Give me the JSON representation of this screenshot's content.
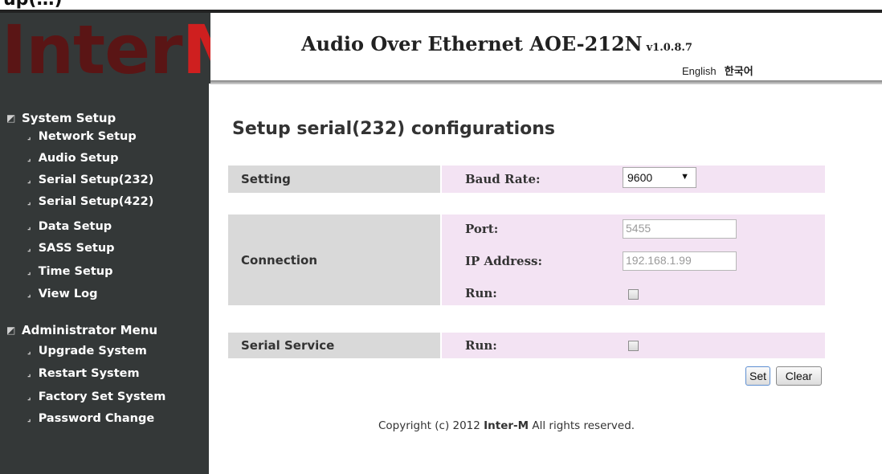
{
  "top_caption": "up(…)",
  "logo": {
    "main": "Inter",
    "accent": "M"
  },
  "header": {
    "title": "Audio Over Ethernet AOE-212N",
    "version": "v1.0.8.7",
    "languages": {
      "english": "English",
      "korean": "한국어"
    }
  },
  "sidebar": {
    "sections": [
      {
        "title": "System Setup",
        "items": [
          "Network Setup",
          "Audio Setup",
          "Serial Setup(232)",
          "Serial Setup(422)",
          "Data Setup",
          "SASS Setup",
          "Time Setup",
          "View Log"
        ]
      },
      {
        "title": "Administrator Menu",
        "items": [
          "Upgrade System",
          "Restart System",
          "Factory Set System",
          "Password Change"
        ]
      }
    ]
  },
  "main": {
    "page_title": "Setup serial(232) configurations",
    "setting": {
      "label": "Setting",
      "baud_label": "Baud Rate:",
      "baud_value": "9600"
    },
    "connection": {
      "label": "Connection",
      "port_label": "Port:",
      "port_placeholder": "5455",
      "ip_label": "IP Address:",
      "ip_placeholder": "192.168.1.99",
      "run_label": "Run:",
      "run_checked": false
    },
    "serial_service": {
      "label": "Serial Service",
      "run_label": "Run:",
      "run_checked": false
    },
    "buttons": {
      "set": "Set",
      "clear": "Clear"
    }
  },
  "footer": {
    "prefix": "Copyright (c) 2012 ",
    "brand": "Inter-M",
    "suffix": " All rights reserved."
  },
  "colors": {
    "sidebar_bg": "#343838",
    "logo_red": "#cf1f1f",
    "label_bg": "#d9d9d9",
    "panel_bg": "#f3e3f3"
  }
}
